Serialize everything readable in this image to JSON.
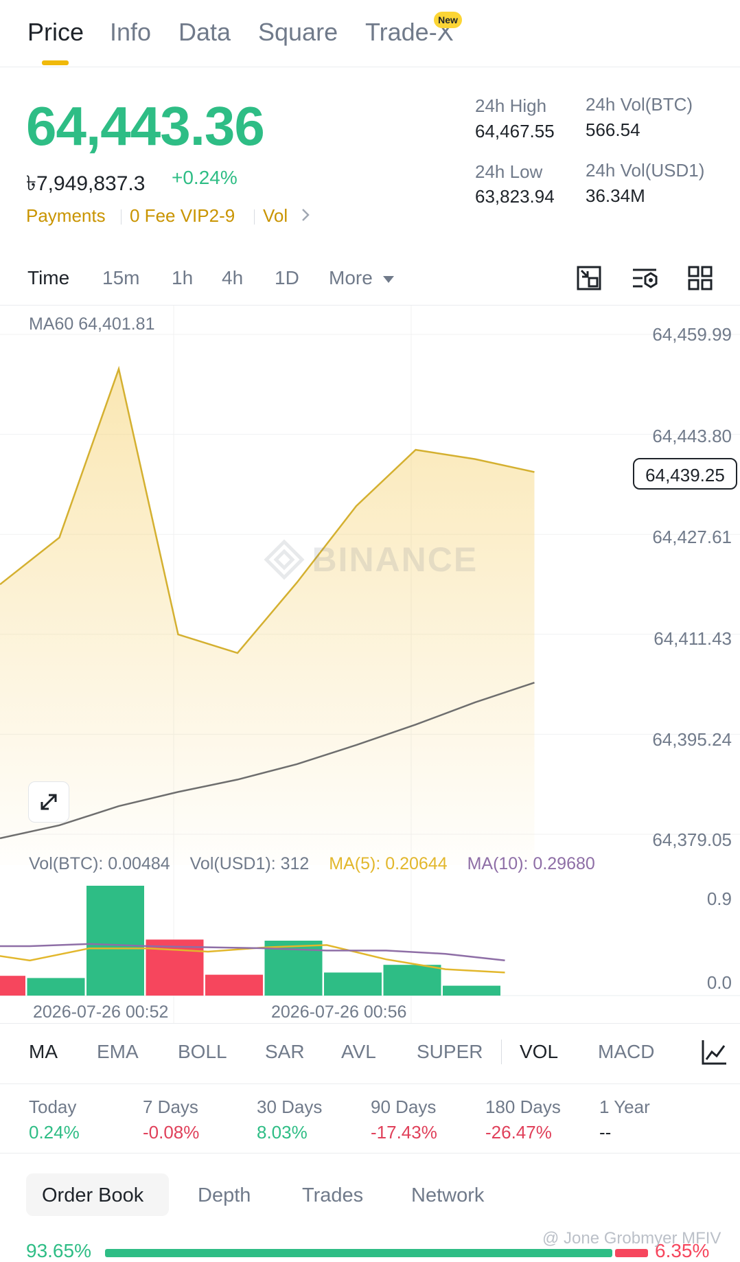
{
  "tabs": [
    {
      "label": "Price",
      "active": true
    },
    {
      "label": "Info",
      "active": false
    },
    {
      "label": "Data",
      "active": false
    },
    {
      "label": "Square",
      "active": false
    },
    {
      "label": "Trade-X",
      "active": false
    }
  ],
  "new_badge": "New",
  "ticker": {
    "price": "64,443.36",
    "local_price": "৳7,949,837.3",
    "change_pct": "+0.24%",
    "price_color": "#2ebd85"
  },
  "promo": {
    "payments": "Payments",
    "fee": "0 Fee VIP2-9",
    "vol": "Vol",
    "chevron_icon": "chevron-right-icon"
  },
  "stats": {
    "high_label": "24h High",
    "high_value": "64,467.55",
    "low_label": "24h Low",
    "low_value": "63,823.94",
    "vol_btc_label": "24h Vol(BTC)",
    "vol_btc_value": "566.54",
    "vol_usd_label": "24h Vol(USD1)",
    "vol_usd_value": "36.34M"
  },
  "intervals": [
    "Time",
    "15m",
    "1h",
    "4h",
    "1D",
    "More"
  ],
  "active_interval": "Time",
  "toolbar_icons": [
    "fullscreen-exit-icon",
    "chart-settings-icon",
    "grid-layout-icon"
  ],
  "chart": {
    "ma60_label": "MA60 64,401.81",
    "watermark": "BINANCE",
    "current_price_tag": "64,439.25",
    "y_ticks": [
      "64,459.99",
      "64,443.80",
      "64,427.61",
      "64,411.43",
      "64,395.24",
      "64,379.05"
    ],
    "vol_info": {
      "vol_btc": "Vol(BTC): 0.00484",
      "vol_usd": "Vol(USD1): 312",
      "ma5": "MA(5): 0.20644",
      "ma10": "MA(10): 0.29680"
    },
    "vol_ticks": [
      "0.9",
      "0.0"
    ],
    "x_labels": [
      "2026-07-26 00:52",
      "2026-07-26 00:56"
    ],
    "colors": {
      "line": "#d4b030",
      "ma60": "#6e6e6e",
      "up": "#2ebd85",
      "down": "#f6465d",
      "ma5": "#e2b72c",
      "ma10": "#8e6ea6"
    }
  },
  "chart_data": {
    "type": "line",
    "price_series": {
      "x_index": [
        0,
        1,
        2,
        3,
        4,
        5,
        6,
        7,
        8,
        9
      ],
      "values": [
        64419.5,
        64427.1,
        64454.4,
        64411.4,
        64408.4,
        64419.8,
        64432.2,
        64441.3,
        64439.8,
        64437.7
      ]
    },
    "ma60": {
      "values": [
        64378.4,
        64380.5,
        64383.6,
        64385.9,
        64387.9,
        64390.4,
        64393.5,
        64396.8,
        64400.4,
        64403.6
      ]
    },
    "ylim": [
      64379.05,
      64459.99
    ],
    "volume": {
      "values": [
        0.18,
        0.16,
        1.0,
        0.51,
        0.19,
        0.5,
        0.21,
        0.28,
        0.09
      ],
      "direction": [
        "down",
        "up",
        "up",
        "down",
        "down",
        "up",
        "up",
        "up",
        "up"
      ],
      "ma5": [
        0.4,
        0.32,
        0.43,
        0.43,
        0.4,
        0.44,
        0.46,
        0.33,
        0.24,
        0.21
      ],
      "ma10": [
        0.45,
        0.45,
        0.47,
        0.45,
        0.44,
        0.43,
        0.41,
        0.41,
        0.38,
        0.32
      ],
      "ylim": [
        0.0,
        0.9
      ]
    }
  },
  "indicators": [
    {
      "label": "MA",
      "active": true
    },
    {
      "label": "EMA",
      "active": false
    },
    {
      "label": "BOLL",
      "active": false
    },
    {
      "label": "SAR",
      "active": false
    },
    {
      "label": "AVL",
      "active": false
    },
    {
      "label": "SUPER",
      "active": false
    },
    {
      "label": "VOL",
      "active": true
    },
    {
      "label": "MACD",
      "active": false
    }
  ],
  "indicator_icon": "indicator-chart-icon",
  "performance": [
    {
      "label": "Today",
      "value": "0.24%",
      "color": "#2ebd85"
    },
    {
      "label": "7 Days",
      "value": "-0.08%",
      "color": "#e0405a"
    },
    {
      "label": "30 Days",
      "value": "8.03%",
      "color": "#2ebd85"
    },
    {
      "label": "90 Days",
      "value": "-17.43%",
      "color": "#e0405a"
    },
    {
      "label": "180 Days",
      "value": "-26.47%",
      "color": "#e0405a"
    },
    {
      "label": "1 Year",
      "value": "--",
      "color": "#1e2329"
    }
  ],
  "orderbook_tabs": [
    "Order Book",
    "Depth",
    "Trades",
    "Network"
  ],
  "ratio": {
    "buy": "93.65%",
    "sell": "6.35%"
  },
  "credit": "@ Jone Grobmyer MFIV"
}
